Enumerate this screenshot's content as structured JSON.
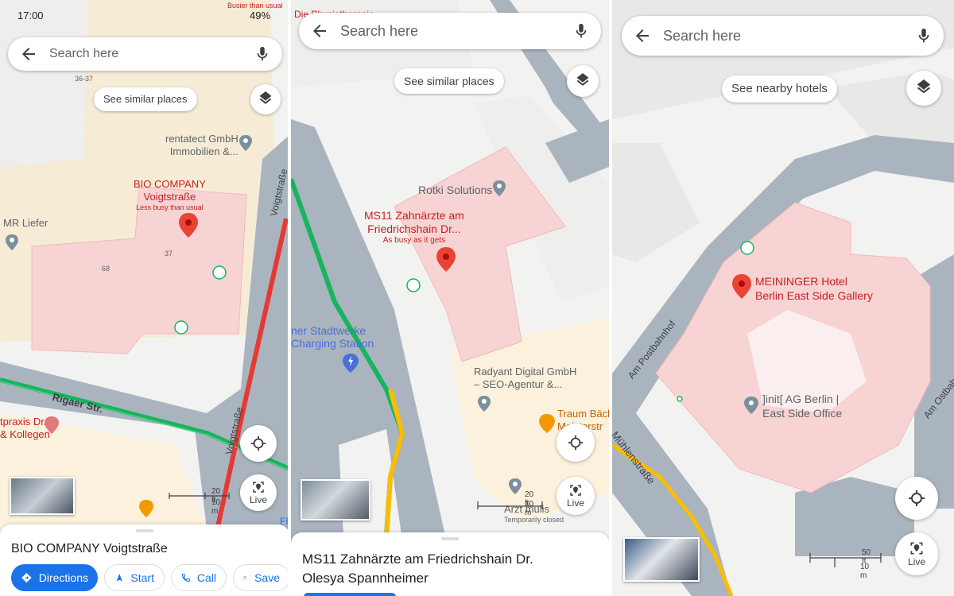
{
  "status": {
    "time": "17:00",
    "battery": "49%",
    "busier_note": "Busier than usual"
  },
  "panel1": {
    "search": {
      "placeholder": "Search here"
    },
    "chip": "See similar places",
    "places": {
      "rentatect": [
        "rentatect GmbH",
        "Immobilien &..."
      ],
      "bio": [
        "BIO COMPANY",
        "Voigtstraße"
      ],
      "bio_busy": "Less busy than usual",
      "mr": "MR Liefer",
      "praxis": [
        "tpraxis Dr.",
        "& Kollegen"
      ]
    },
    "numbers": {
      "n1": "36-37",
      "n2": "37",
      "n3": "68"
    },
    "streets": {
      "rigaer": "Rigaer Str.",
      "voigt1": "Voigtstraße",
      "voigt2": "Voigtstraße"
    },
    "scale": {
      "ft": "20 ft",
      "m": "10 m"
    },
    "live": "Live",
    "sheet": {
      "title": "BIO COMPANY Voigtstraße",
      "actions": [
        "Directions",
        "Start",
        "Call",
        "Save"
      ]
    },
    "edge_text": "FE"
  },
  "panel2": {
    "top_fragment": "Die Physiotherapie",
    "search": {
      "placeholder": "Search here"
    },
    "chip": "See similar places",
    "places": {
      "rotki": "Rotki Solutions",
      "ms11": [
        "MS11 Zahnärzte am",
        "Friedrichshain Dr..."
      ],
      "ms11_busy": "As busy as it gets",
      "stadtwerke": [
        "ner Stadtwerke",
        "Charging Station"
      ],
      "radyant": [
        "Radyant Digital GmbH",
        "– SEO-Agentur &..."
      ],
      "traum": [
        "Traum Bäck",
        "Meisterstr"
      ],
      "arzt": "Arzt mulis",
      "arzt_status": "Temporarily closed"
    },
    "scale": {
      "ft": "20 ft",
      "m": "10 m"
    },
    "live": "Live",
    "sheet": {
      "title": [
        "MS11 Zahnärzte am Friedrichshain Dr.",
        "Olesya Spannheimer"
      ]
    }
  },
  "panel3": {
    "search": {
      "placeholder": "Search here"
    },
    "chip": "See nearby hotels",
    "places": {
      "meininger": [
        "MEININGER Hotel",
        "Berlin East Side Gallery"
      ],
      "init": [
        "]init[ AG Berlin |",
        "East Side Office"
      ]
    },
    "streets": {
      "postbahnhof": "Am Postbahnhof",
      "muehlen": "Mühlenstraße",
      "ostbahnhof": "Am Ostbahnhof"
    },
    "scale": {
      "ft": "50 ft",
      "m": "10 m"
    },
    "live": "Live"
  },
  "colors": {
    "road": "#aab4bf",
    "road_outline": "#ffffff",
    "building": "#f8d3d3",
    "block": "#fbf1dd",
    "pin": "#ea4335",
    "traffic_green": "#16b55e",
    "traffic_red": "#e53935",
    "traffic_yellow": "#fbbc04",
    "accent": "#1a73e8"
  },
  "icons": [
    "arrow-back-icon",
    "mic-icon",
    "layers-icon",
    "my-location-icon",
    "live-view-icon",
    "directions-icon",
    "navigation-icon",
    "phone-icon",
    "bookmark-icon",
    "place-pin-icon",
    "grey-pin-icon",
    "transit-icon",
    "ev-charger-icon",
    "restaurant-icon",
    "medical-icon"
  ]
}
